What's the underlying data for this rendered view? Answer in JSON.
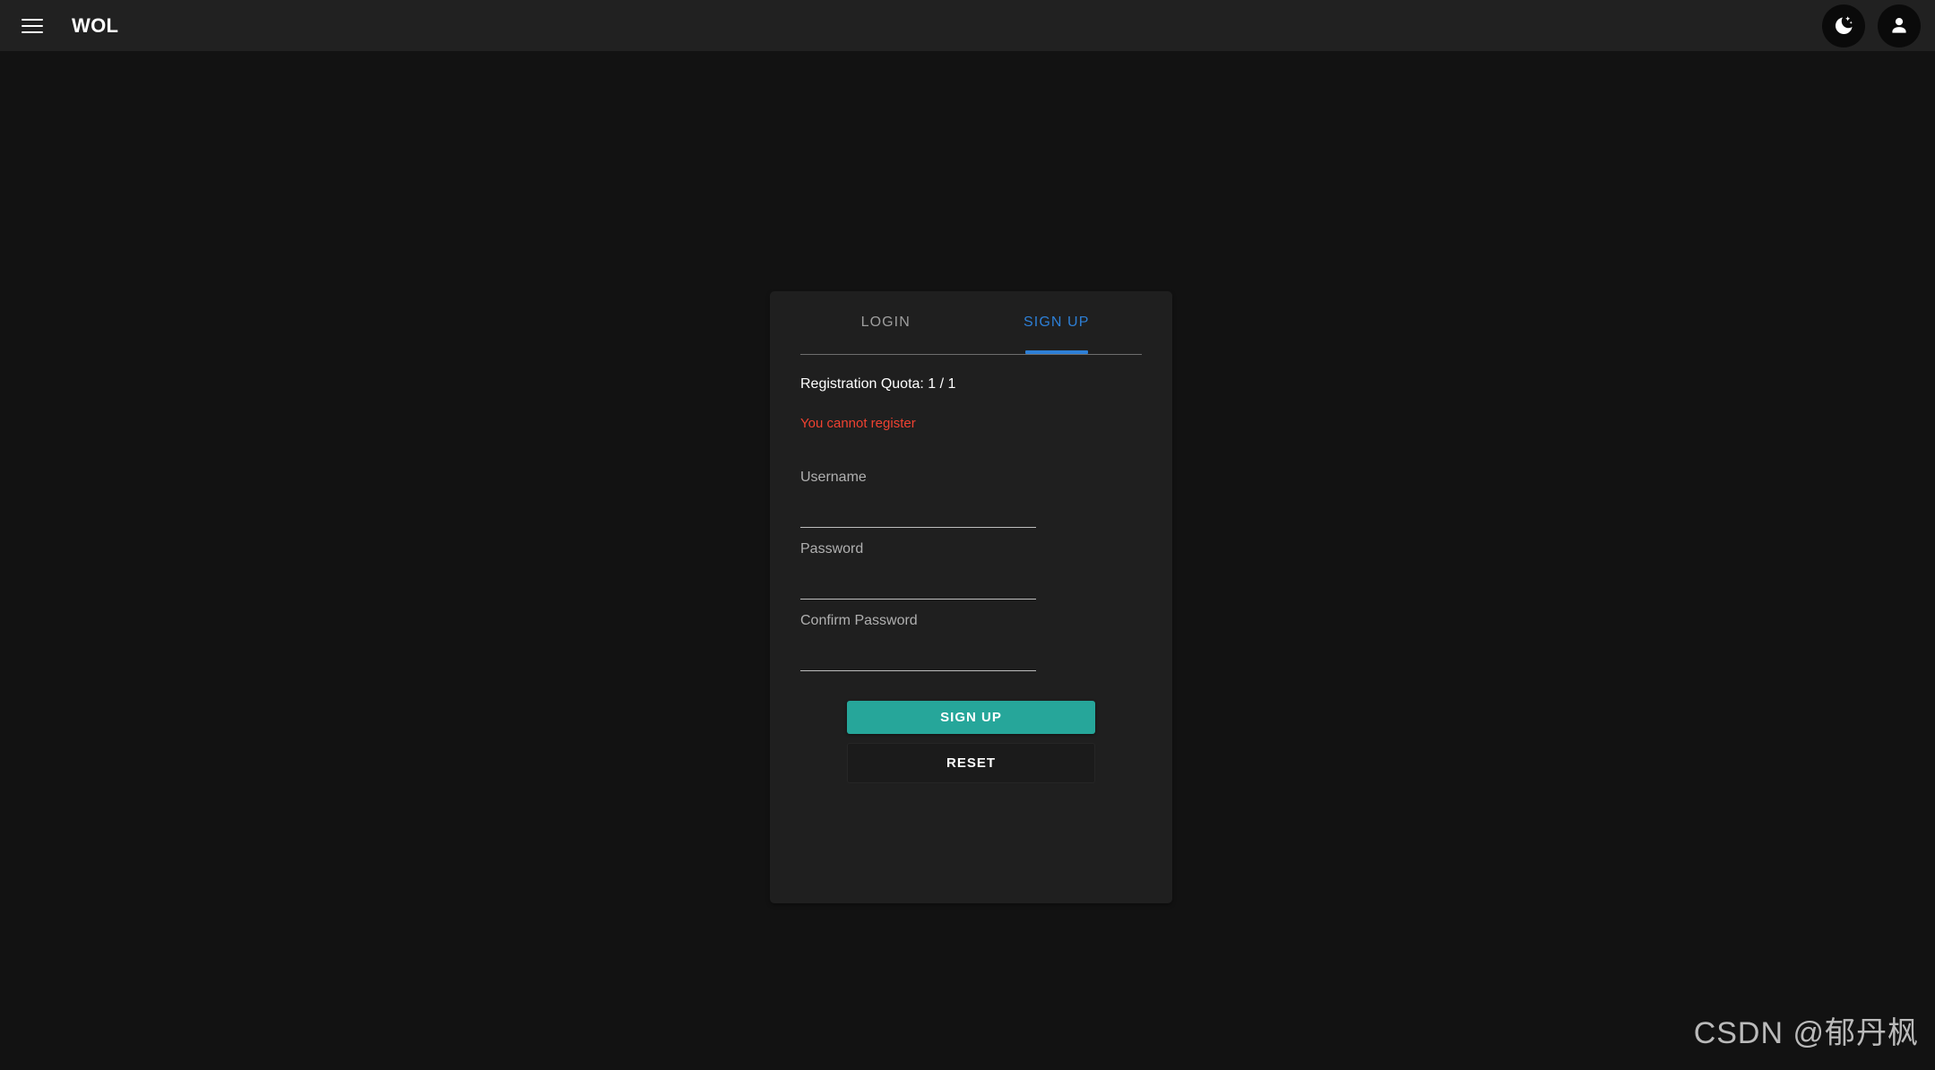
{
  "appbar": {
    "menu_icon": "hamburger-menu-icon",
    "brand": "WOL",
    "theme_toggle_icon": "dark-mode-moon-icon",
    "account_icon": "account-person-icon"
  },
  "card": {
    "tabs": [
      {
        "label": "LOGIN",
        "active": false
      },
      {
        "label": "SIGN UP",
        "active": true
      }
    ],
    "quota_text": "Registration Quota: 1 / 1",
    "warning_text": "You cannot register",
    "fields": [
      {
        "label": "Username",
        "value": "",
        "placeholder": ""
      },
      {
        "label": "Password",
        "value": "",
        "placeholder": ""
      },
      {
        "label": "Confirm Password",
        "value": "",
        "placeholder": ""
      }
    ],
    "buttons": {
      "submit": "SIGN UP",
      "reset": "RESET"
    }
  },
  "watermark": "CSDN @郁丹枫",
  "colors": {
    "page_background": "#121212",
    "appbar_background": "#212121",
    "card_background": "#1f1f1f",
    "tab_active": "#2d7fd6",
    "tab_inactive": "#9e9e9e",
    "warning": "#ef4231",
    "submit_button": "#26a69a"
  }
}
